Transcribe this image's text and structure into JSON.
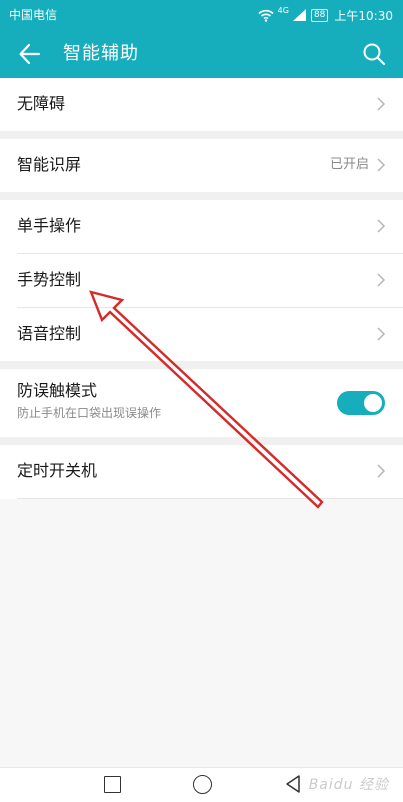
{
  "status_bar": {
    "carrier": "中国电信",
    "network": "4G",
    "battery": "88",
    "time": "上午10:30"
  },
  "app_bar": {
    "title": "智能辅助",
    "back_icon": "arrow-left-icon",
    "search_icon": "search-icon"
  },
  "groups": [
    {
      "items": [
        {
          "label": "无障碍"
        }
      ]
    },
    {
      "items": [
        {
          "label": "智能识屏",
          "value": "已开启"
        }
      ]
    },
    {
      "items": [
        {
          "label": "单手操作"
        },
        {
          "label": "手势控制"
        },
        {
          "label": "语音控制"
        }
      ]
    },
    {
      "items": [
        {
          "label": "防误触模式",
          "subtitle": "防止手机在口袋出现误操作",
          "toggle_on": true
        }
      ]
    },
    {
      "items": [
        {
          "label": "定时开关机"
        }
      ]
    }
  ],
  "accent_color": "#16aebd",
  "annotation_color": "#d42a2a",
  "watermark": "Baidu 经验"
}
